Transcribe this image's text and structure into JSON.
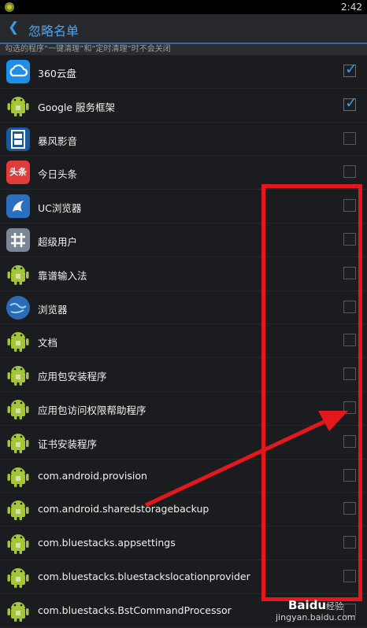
{
  "status": {
    "time": "2:42"
  },
  "header": {
    "back_icon": "chevron-left-icon",
    "title": "忽略名单"
  },
  "hint": "勾选的程序“一键清理”和“定时清理”时不会关闭",
  "apps": [
    {
      "label": "360云盘",
      "icon": "cloud-icon",
      "checked": true
    },
    {
      "label": "Google 服务框架",
      "icon": "android-icon",
      "checked": true
    },
    {
      "label": "暴风影音",
      "icon": "baofeng-icon",
      "checked": false
    },
    {
      "label": "今日头条",
      "icon": "toutiao-icon",
      "checked": false
    },
    {
      "label": "UC浏览器",
      "icon": "uc-icon",
      "checked": false
    },
    {
      "label": "超级用户",
      "icon": "superuser-icon",
      "checked": false
    },
    {
      "label": "靠谱输入法",
      "icon": "android-icon",
      "checked": false
    },
    {
      "label": "浏览器",
      "icon": "globe-icon",
      "checked": false
    },
    {
      "label": "文档",
      "icon": "android-icon",
      "checked": false
    },
    {
      "label": "应用包安装程序",
      "icon": "android-icon",
      "checked": false
    },
    {
      "label": "应用包访问权限帮助程序",
      "icon": "android-icon",
      "checked": false
    },
    {
      "label": "证书安装程序",
      "icon": "android-icon",
      "checked": false
    },
    {
      "label": "com.android.provision",
      "icon": "android-icon",
      "checked": false
    },
    {
      "label": "com.android.sharedstoragebackup",
      "icon": "android-icon",
      "checked": false
    },
    {
      "label": "com.bluestacks.appsettings",
      "icon": "android-icon",
      "checked": false
    },
    {
      "label": "com.bluestacks.bluestackslocationprovider",
      "icon": "android-icon",
      "checked": false
    },
    {
      "label": "com.bluestacks.BstCommandProcessor",
      "icon": "android-icon",
      "checked": false
    }
  ],
  "icon_text": {
    "toutiao": "头条"
  },
  "watermark": {
    "brand": "Baidu",
    "brand_cn": "经验",
    "url": "jingyan.baidu.com"
  },
  "colors": {
    "accent": "#3b9ae0",
    "annotation": "#e4181c"
  }
}
